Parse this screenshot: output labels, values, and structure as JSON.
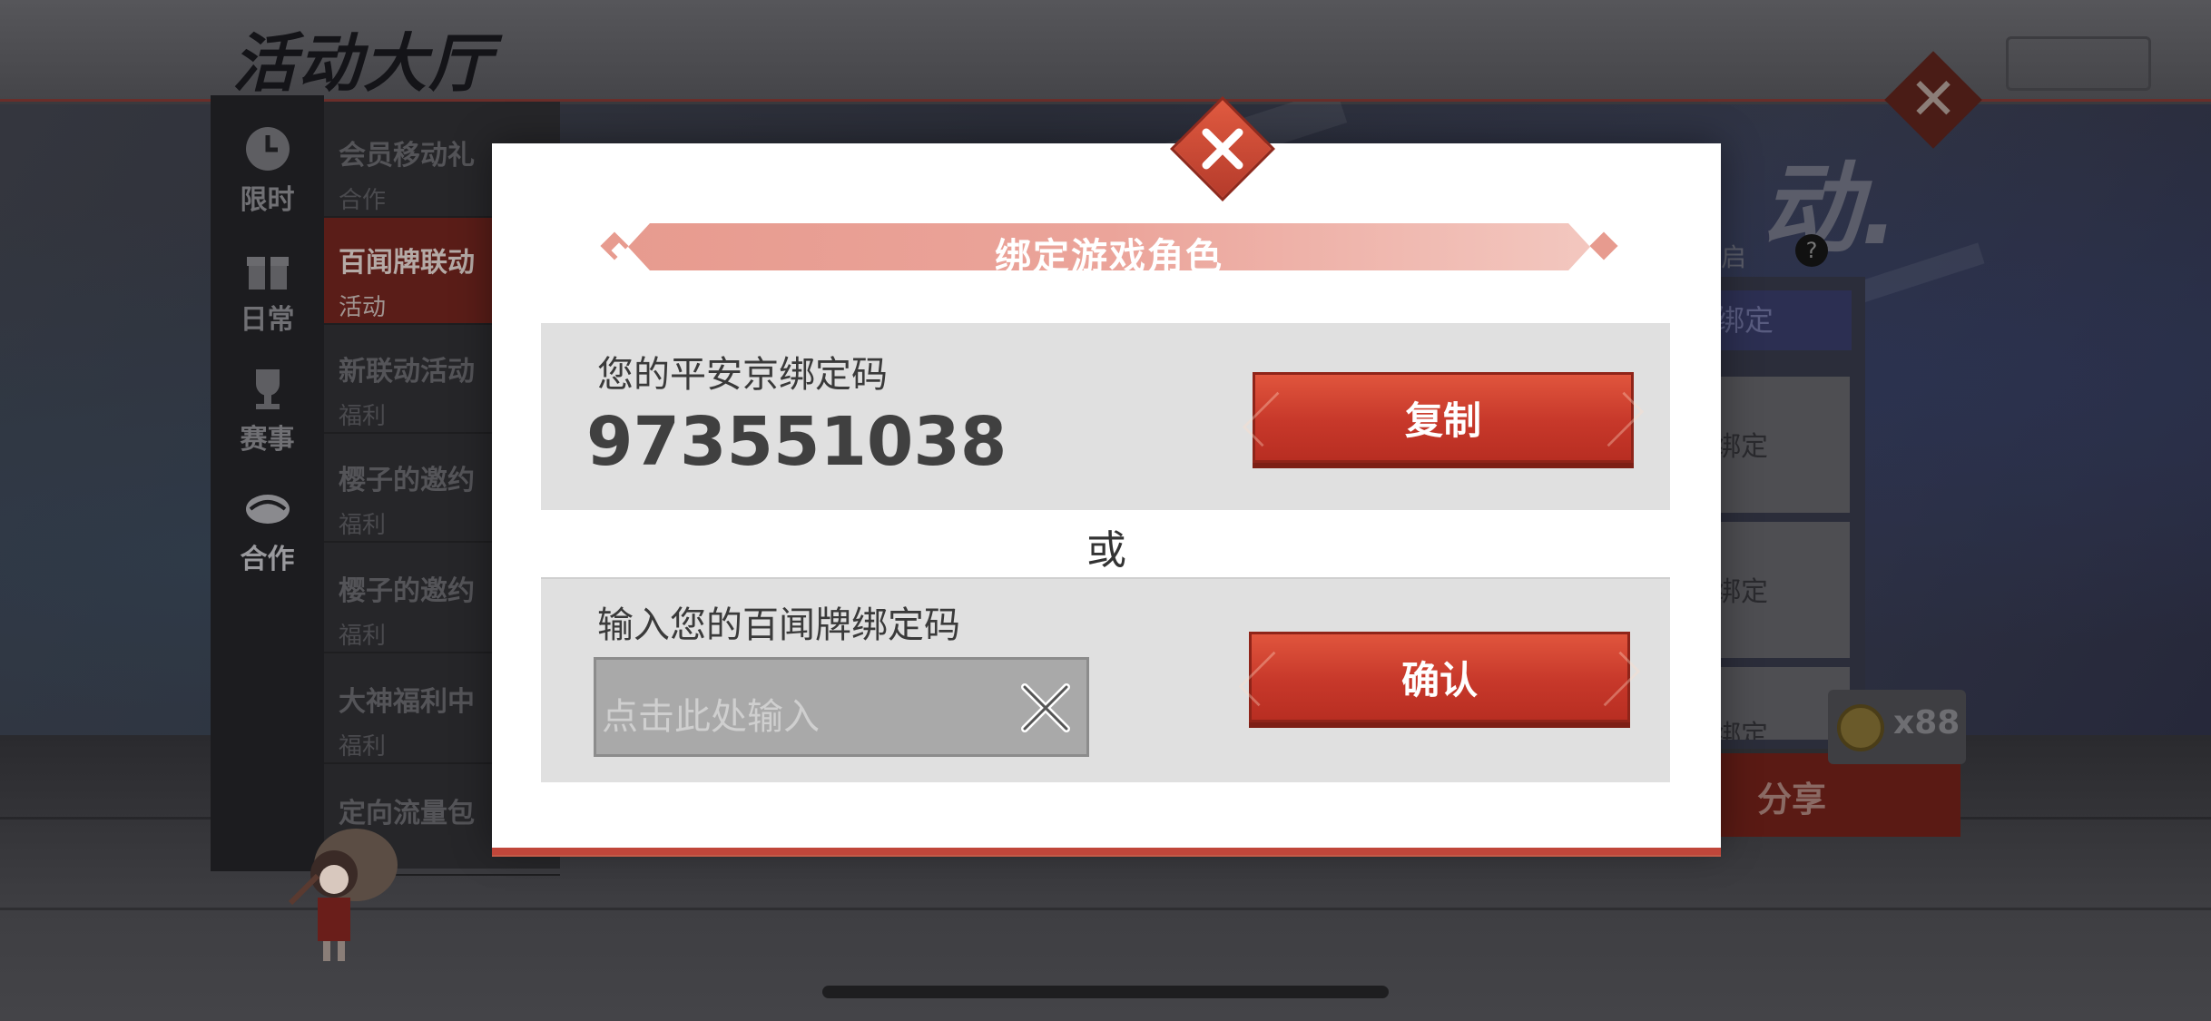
{
  "background": {
    "page_title": "活动大厅",
    "nav": [
      {
        "label": "限时",
        "icon": "clock-icon"
      },
      {
        "label": "日常",
        "icon": "gift-icon"
      },
      {
        "label": "赛事",
        "icon": "trophy-icon"
      },
      {
        "label": "合作",
        "icon": "handshake-icon"
      }
    ],
    "list": [
      {
        "title": "会员移动礼",
        "sub": "合作"
      },
      {
        "title": "百闻牌联动",
        "sub": "活动"
      },
      {
        "title": "新联动活动",
        "sub": "福利"
      },
      {
        "title": "樱子的邀约",
        "sub": "福利"
      },
      {
        "title": "樱子的邀约",
        "sub": "福利"
      },
      {
        "title": "大神福利中",
        "sub": "福利"
      },
      {
        "title": "定向流量包",
        "sub": ""
      }
    ],
    "right_big_text": "动.",
    "right_small_text": "启",
    "help_glyph": "?",
    "bind_chip": "绑定",
    "cards": [
      "绑定",
      "绑定",
      "绑定"
    ],
    "coin_count": "x88",
    "share_label": "分享"
  },
  "modal": {
    "title": "绑定游戏角色",
    "code_label": "您的平安京绑定码",
    "code_value": "973551038",
    "copy_button": "复制",
    "or_text": "或",
    "input_label": "输入您的百闻牌绑定码",
    "input_placeholder": "点击此处输入",
    "confirm_button": "确认"
  },
  "colors": {
    "accent_red": "#c7382a",
    "ribbon_pink": "#e79b8f",
    "panel_gray": "#e0e0e0"
  }
}
